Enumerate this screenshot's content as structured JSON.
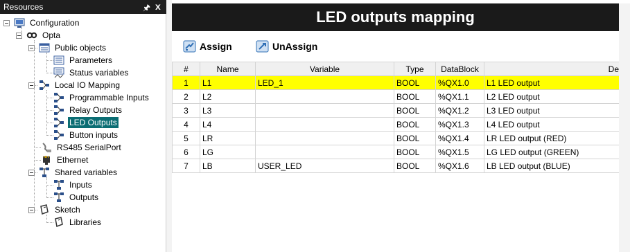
{
  "resources_panel": {
    "title": "Resources",
    "pin_icon": "pin-icon",
    "close_label": "x"
  },
  "tree": [
    {
      "label": "Configuration",
      "icon": "configuration-icon"
    },
    {
      "label": "Opta",
      "icon": "opta-icon"
    },
    {
      "label": "Public objects",
      "icon": "public-objects-icon"
    },
    {
      "label": "Parameters",
      "icon": "parameters-icon"
    },
    {
      "label": "Status variables",
      "icon": "status-variables-icon"
    },
    {
      "label": "Local IO Mapping",
      "icon": "io-mapping-icon"
    },
    {
      "label": "Programmable Inputs",
      "icon": "io-mapping-icon"
    },
    {
      "label": "Relay Outputs",
      "icon": "io-mapping-icon"
    },
    {
      "label": "LED Outputs",
      "icon": "io-mapping-icon",
      "selected": true
    },
    {
      "label": "Button inputs",
      "icon": "io-mapping-icon"
    },
    {
      "label": "RS485 SerialPort",
      "icon": "serial-port-icon"
    },
    {
      "label": "Ethernet",
      "icon": "ethernet-icon"
    },
    {
      "label": "Shared variables",
      "icon": "shared-variables-icon"
    },
    {
      "label": "Inputs",
      "icon": "shared-variables-icon"
    },
    {
      "label": "Outputs",
      "icon": "shared-variables-icon"
    },
    {
      "label": "Sketch",
      "icon": "sketch-icon"
    },
    {
      "label": "Libraries",
      "icon": "libraries-icon"
    }
  ],
  "editor": {
    "title": "LED outputs mapping",
    "toolbar": {
      "assign_label": "Assign",
      "unassign_label": "UnAssign"
    },
    "table": {
      "headers": [
        "#",
        "Name",
        "Variable",
        "Type",
        "DataBlock",
        "Desc"
      ],
      "rows": [
        {
          "num": "1",
          "name": "L1",
          "variable": "LED_1",
          "type": "BOOL",
          "datablock": "%QX1.0",
          "desc": "L1 LED output",
          "highlighted": true
        },
        {
          "num": "2",
          "name": "L2",
          "variable": "",
          "type": "BOOL",
          "datablock": "%QX1.1",
          "desc": "L2 LED output"
        },
        {
          "num": "3",
          "name": "L3",
          "variable": "",
          "type": "BOOL",
          "datablock": "%QX1.2",
          "desc": "L3 LED output"
        },
        {
          "num": "4",
          "name": "L4",
          "variable": "",
          "type": "BOOL",
          "datablock": "%QX1.3",
          "desc": "L4 LED output"
        },
        {
          "num": "5",
          "name": "LR",
          "variable": "",
          "type": "BOOL",
          "datablock": "%QX1.4",
          "desc": "LR LED output (RED)"
        },
        {
          "num": "6",
          "name": "LG",
          "variable": "",
          "type": "BOOL",
          "datablock": "%QX1.5",
          "desc": "LG LED output (GREEN)"
        },
        {
          "num": "7",
          "name": "LB",
          "variable": "USER_LED",
          "type": "BOOL",
          "datablock": "%QX1.6",
          "desc": "LB LED output (BLUE)"
        }
      ]
    }
  },
  "colors": {
    "selected_tree_item": "#0b6d73",
    "highlight_row": "#ffff00",
    "title_bar": "#1a1a1a"
  }
}
